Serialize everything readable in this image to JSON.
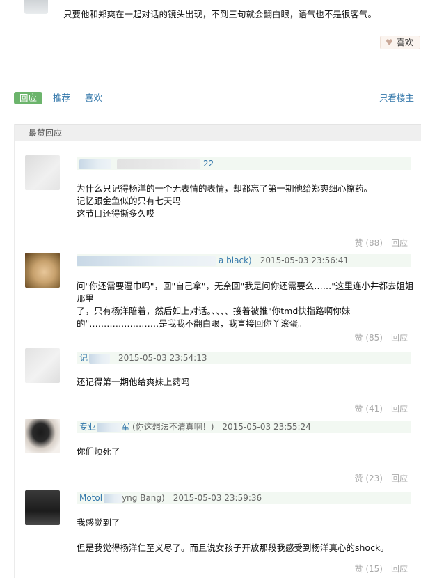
{
  "top_post": {
    "text": "只要他和郑爽在一起对话的镜头出现，不到三句就会翻白眼，语气也不是很客气。",
    "like_label": "喜欢"
  },
  "tabs": {
    "reply": "回应",
    "recommend": "推荐",
    "like": "喜欢",
    "only_op": "只看楼主"
  },
  "hot_title": "最赞回应",
  "comments": [
    {
      "author_suffix": "22",
      "time": "",
      "lines": [
        "为什么只记得杨洋的一个无表情的表情，却都忘了第一期他给郑爽细心擦药。",
        "记忆跟金鱼似的只有七天吗",
        "这节目还得撕多久哎"
      ],
      "zan": "赞",
      "zan_count": "(88)",
      "reply": "回应"
    },
    {
      "author_suffix": "a black)",
      "time": "2015-05-03 23:56:41",
      "lines": [
        "问\"你还需要湿巾吗\"，回\"自己拿\"，无奈回\"我是问你还需要么……\"这里连小井都去姐姐那里",
        "了，只有杨洋陪着，然后如上对话。、、、、接着被推\"你tmd快指路啊你妹",
        "的\"……………………是我我不翻白眼，我直接回你丫滚蛋。"
      ],
      "zan": "赞",
      "zan_count": "(85)",
      "reply": "回应"
    },
    {
      "author_prefix": "记",
      "time": "2015-05-03 23:54:13",
      "lines": [
        "还记得第一期他给爽妹上药吗"
      ],
      "zan": "赞",
      "zan_count": "(41)",
      "reply": "回应"
    },
    {
      "author_prefix": "专业",
      "author_suffix": "军",
      "signature": "(你这想法不清真啊！)",
      "time": "2015-05-03 23:55:24",
      "lines": [
        "你们烦死了"
      ],
      "zan": "赞",
      "zan_count": "(23)",
      "reply": "回应"
    },
    {
      "author_prefix": "Motol",
      "author_suffix": "yng Bang)",
      "time": "2015-05-03 23:59:36",
      "lines": [
        "我感觉到了",
        "",
        "但是我觉得杨洋仁至义尽了。而且说女孩子开放那段我感受到杨洋真心的shock。"
      ],
      "zan": "赞",
      "zan_count": "(15)",
      "reply": "回应"
    }
  ],
  "colors": {
    "link": "#3377aa",
    "tab_active_bg": "#6cb46c",
    "meta_bg": "#f2f8f2"
  }
}
